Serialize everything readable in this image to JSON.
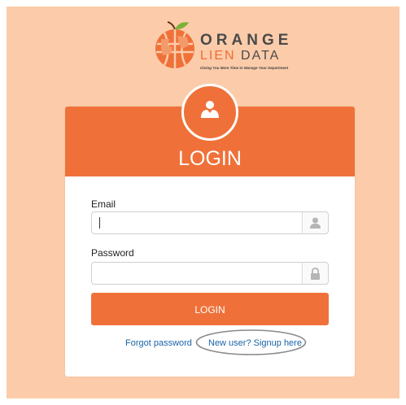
{
  "brand": {
    "line1": "ORANGE",
    "line2_part1": "LIEN",
    "line2_part2": "DATA",
    "tagline": "Giving You More Time to Manage Your Department"
  },
  "card": {
    "title": "LOGIN"
  },
  "form": {
    "email_label": "Email",
    "email_value": "",
    "password_label": "Password",
    "password_value": "",
    "submit_label": "LOGIN"
  },
  "links": {
    "forgot": "Forgot password",
    "signup": "New user? Signup here"
  },
  "colors": {
    "page_background": "#fcccaa",
    "accent": "#ef7139",
    "link": "#1a63a8",
    "annotation_circle": "#8a8a8a"
  },
  "icons": {
    "logo": "orange-globe-logo",
    "avatar": "user-avatar-icon",
    "email_addon": "user-icon",
    "password_addon": "lock-icon"
  }
}
